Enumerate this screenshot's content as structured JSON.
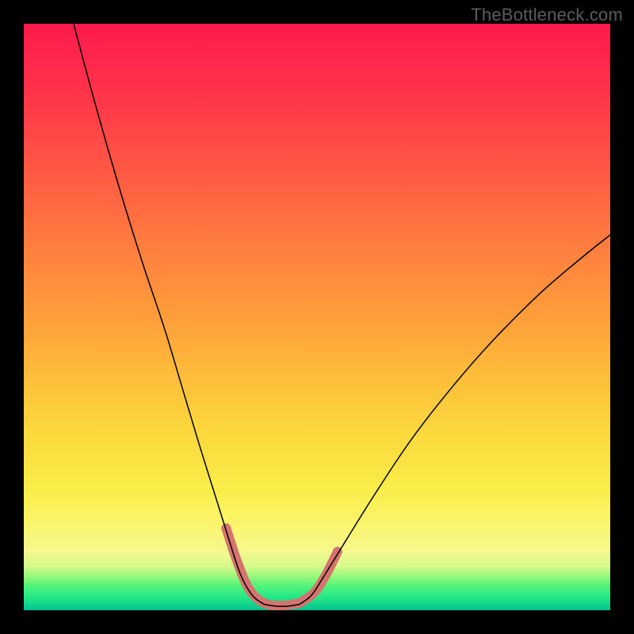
{
  "watermark": "TheBottleneck.com",
  "chart_data": {
    "type": "line",
    "title": "",
    "xlabel": "",
    "ylabel": "",
    "x_range": [
      0,
      100
    ],
    "y_range": [
      0,
      100
    ],
    "gradient_stops": [
      {
        "pos": 0,
        "color": "#ff1a4d"
      },
      {
        "pos": 25,
        "color": "#ff5844"
      },
      {
        "pos": 50,
        "color": "#ff9e3a"
      },
      {
        "pos": 70,
        "color": "#fbd93d"
      },
      {
        "pos": 85,
        "color": "#faf56a"
      },
      {
        "pos": 94,
        "color": "#8bf779"
      },
      {
        "pos": 100,
        "color": "#04c18e"
      }
    ],
    "series": [
      {
        "name": "bottleneck-curve-left",
        "stroke": "#000000",
        "stroke_width": 1.5,
        "points": [
          {
            "x": 8.5,
            "y": 100
          },
          {
            "x": 12,
            "y": 87
          },
          {
            "x": 16,
            "y": 73
          },
          {
            "x": 20,
            "y": 60
          },
          {
            "x": 24,
            "y": 48
          },
          {
            "x": 27,
            "y": 38
          },
          {
            "x": 30,
            "y": 28
          },
          {
            "x": 32.5,
            "y": 20
          },
          {
            "x": 35,
            "y": 12
          },
          {
            "x": 37,
            "y": 6
          },
          {
            "x": 39,
            "y": 2.5
          },
          {
            "x": 41,
            "y": 1
          }
        ]
      },
      {
        "name": "bottleneck-curve-right",
        "stroke": "#000000",
        "stroke_width": 1.5,
        "points": [
          {
            "x": 47,
            "y": 1
          },
          {
            "x": 49,
            "y": 2.5
          },
          {
            "x": 51,
            "y": 5.5
          },
          {
            "x": 55,
            "y": 12
          },
          {
            "x": 60,
            "y": 20
          },
          {
            "x": 66,
            "y": 29
          },
          {
            "x": 73,
            "y": 38
          },
          {
            "x": 80,
            "y": 46
          },
          {
            "x": 88,
            "y": 54
          },
          {
            "x": 95,
            "y": 60
          },
          {
            "x": 100,
            "y": 64
          }
        ]
      },
      {
        "name": "bottleneck-curve-floor",
        "stroke": "#000000",
        "stroke_width": 1.5,
        "points": [
          {
            "x": 41,
            "y": 1
          },
          {
            "x": 43,
            "y": 0.7
          },
          {
            "x": 45,
            "y": 0.7
          },
          {
            "x": 47,
            "y": 1
          }
        ]
      }
    ],
    "highlight_segments": [
      {
        "name": "highlight-left",
        "stroke": "#d5736f",
        "stroke_width": 12,
        "linecap": "round",
        "points": [
          {
            "x": 34.5,
            "y": 14
          },
          {
            "x": 36.5,
            "y": 8
          },
          {
            "x": 38.5,
            "y": 3.5
          },
          {
            "x": 41,
            "y": 1.2
          },
          {
            "x": 44,
            "y": 0.8
          },
          {
            "x": 47,
            "y": 1.2
          }
        ]
      },
      {
        "name": "highlight-right",
        "stroke": "#d5736f",
        "stroke_width": 12,
        "linecap": "round",
        "points": [
          {
            "x": 47,
            "y": 1.2
          },
          {
            "x": 49.5,
            "y": 3
          },
          {
            "x": 51.5,
            "y": 6
          },
          {
            "x": 53.5,
            "y": 10
          }
        ]
      }
    ]
  }
}
